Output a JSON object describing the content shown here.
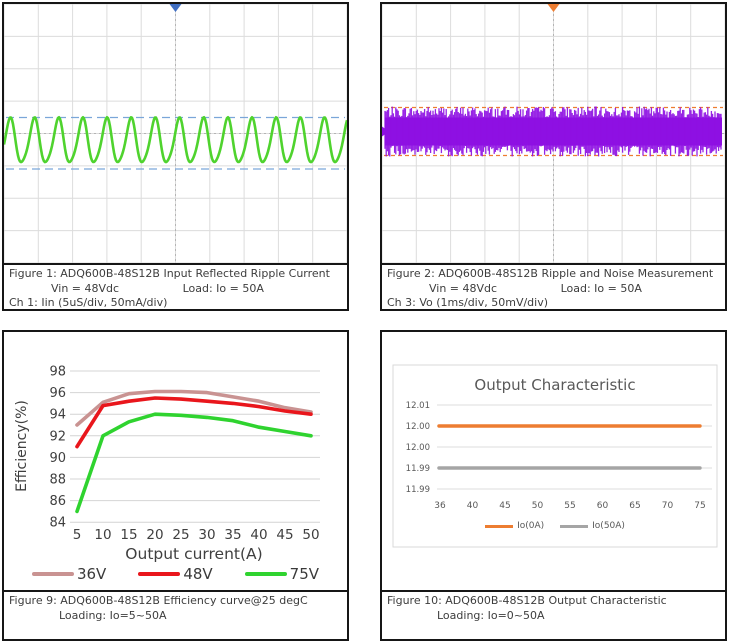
{
  "panels": {
    "fig1": {
      "caption": "Figure 1: ADQ600B-48S12B Input Reflected Ripple Current",
      "cond_vin": "Vin = 48Vdc",
      "cond_load": "Load: Io = 50A",
      "channel": "Ch 1: Iin (5uS/div, 50mA/div)",
      "scope": {
        "type": "sine_ripple",
        "cycles": 14.2,
        "trace_color": "#4fd32e",
        "cursor_color": "#7aa6d9",
        "marker_color": "#3f6ec2",
        "grid_color": "#dcdcdc",
        "divisions_x": 10,
        "divisions_y": 8
      }
    },
    "fig2": {
      "caption": "Figure 2: ADQ600B-48S12B Ripple and Noise Measurement",
      "cond_vin": "Vin = 48Vdc",
      "cond_load": "Load: Io = 50A",
      "channel": "Ch 3: Vo (1ms/div, 50mV/div)",
      "scope": {
        "type": "noise_band",
        "trace_color": "#8e10e3",
        "cursor_color": "#ed7d31",
        "marker_color": "#ed7d31",
        "grid_color": "#dcdcdc",
        "divisions_x": 10,
        "divisions_y": 8,
        "channel_label": "3"
      }
    },
    "fig9": {
      "caption": "Figure 9: ADQ600B-48S12B Efficiency curve@25 degC",
      "loading": "Loading: Io=5~50A"
    },
    "fig10": {
      "caption": "Figure 10: ADQ600B-48S12B Output Characteristic",
      "loading": "Loading: Io=0~50A"
    }
  },
  "chart_data": [
    {
      "id": "efficiency-curve",
      "type": "line",
      "title": "",
      "xlabel": "Output current(A)",
      "ylabel": "Efficiency(%)",
      "x": [
        5,
        10,
        15,
        20,
        25,
        30,
        35,
        40,
        45,
        50
      ],
      "yticks": [
        84,
        86,
        88,
        90,
        92,
        94,
        96,
        98
      ],
      "ylim": [
        84,
        98
      ],
      "grid": "horizontal",
      "legend_position": "bottom",
      "series": [
        {
          "name": "36V",
          "color": "#c99392",
          "values": [
            93.0,
            95.1,
            95.9,
            96.1,
            96.1,
            96.0,
            95.6,
            95.2,
            94.6,
            94.2
          ]
        },
        {
          "name": "48V",
          "color": "#e9161c",
          "values": [
            91.0,
            94.8,
            95.2,
            95.5,
            95.4,
            95.2,
            95.0,
            94.7,
            94.3,
            94.0
          ]
        },
        {
          "name": "75V",
          "color": "#2fd32f",
          "values": [
            85.0,
            92.0,
            93.3,
            94.0,
            93.9,
            93.7,
            93.4,
            92.8,
            92.4,
            92.0
          ]
        }
      ]
    },
    {
      "id": "output-characteristic",
      "type": "line",
      "title": "Output Characteristic",
      "xlabel": "",
      "ylabel": "",
      "x": [
        36,
        40,
        45,
        50,
        55,
        60,
        65,
        70,
        75
      ],
      "ytick_labels": [
        "12.01",
        "12.00",
        "12.00",
        "11.99",
        "11.99"
      ],
      "grid": "horizontal",
      "legend_position": "bottom",
      "series": [
        {
          "name": "Io(0A)",
          "color": "#ed7d31",
          "gridline_index": 1,
          "values": [
            12.0,
            12.0,
            12.0,
            12.0,
            12.0,
            12.0,
            12.0,
            12.0,
            12.0
          ]
        },
        {
          "name": "Io(50A)",
          "color": "#a5a5a5",
          "gridline_index": 3,
          "values": [
            11.99,
            11.99,
            11.99,
            11.99,
            11.99,
            11.99,
            11.99,
            11.99,
            11.99
          ]
        }
      ]
    }
  ]
}
